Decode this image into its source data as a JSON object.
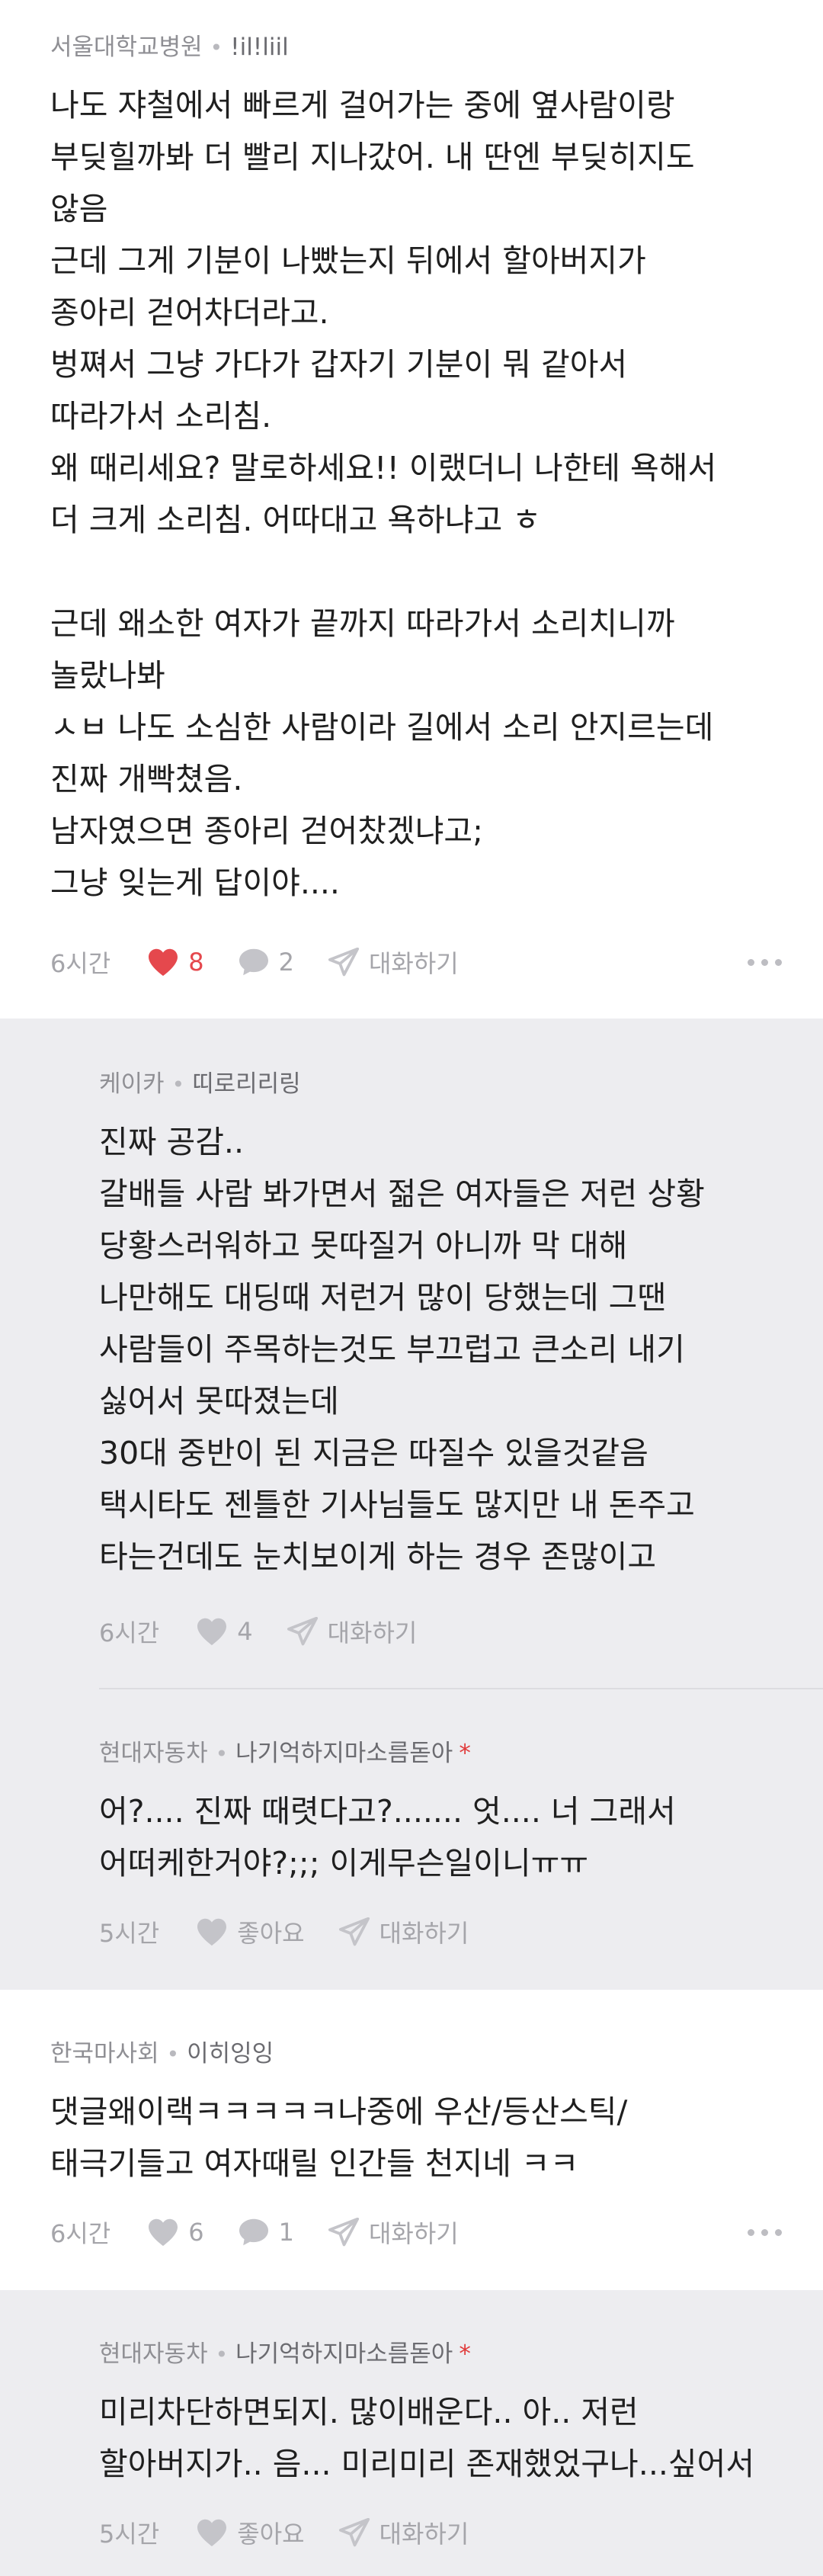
{
  "comments": [
    {
      "company": "서울대학교병원",
      "nickname": "!il!liil",
      "lines": [
        "나도 쟈철에서 빠르게 걸어가는 중에 옆사람이랑",
        "부딪힐까봐 더 빨리 지나갔어. 내 딴엔 부딪히지도",
        "않음",
        "근데 그게 기분이 나빴는지 뒤에서 할아버지가",
        "종아리 걷어차더라고.",
        "벙쪄서 그냥 가다가 갑자기 기분이 뭐 같아서",
        "따라가서 소리침.",
        "왜 때리세요? 말로하세요!! 이랬더니 나한테 욕해서",
        "더 크게 소리침. 어따대고 욕하냐고 ㅎ",
        "",
        "근데 왜소한 여자가 끝까지 따라가서 소리치니까",
        "놀랐나봐",
        "ㅅㅂ 나도 소심한 사람이라 길에서 소리 안지르는데",
        "진짜 개빡쳤음.",
        "남자였으면 종아리 걷어찼겠냐고;",
        "그냥 잊는게 답이야...."
      ],
      "time": "6시간",
      "likes": "8",
      "comments_count": "2",
      "reply_label": "대화하기"
    },
    {
      "company": "케이카",
      "nickname": "띠로리리링",
      "lines": [
        "진짜 공감..",
        "갈배들 사람 봐가면서 젊은 여자들은 저런 상황",
        "당황스러워하고 못따질거 아니까 막 대해",
        "나만해도 대딩때 저런거 많이 당했는데 그땐",
        "사람들이 주목하는것도 부끄럽고 큰소리 내기",
        "싫어서 못따졌는데",
        "30대 중반이 된 지금은 따질수 있을것같음",
        "택시타도 젠틀한 기사님들도 많지만 내 돈주고",
        "타는건데도 눈치보이게 하는 경우 존많이고"
      ],
      "time": "6시간",
      "likes": "4",
      "reply_label": "대화하기"
    },
    {
      "company": "현대자동차",
      "nickname": "나기억하지마소름돋아",
      "author_mark": "*",
      "lines": [
        "어?.... 진짜 때렷다고?....... 엇.... 너 그래서",
        "어떠케한거야?;;; 이게무슨일이니ㅠㅠ"
      ],
      "time": "5시간",
      "like_label": "좋아요",
      "reply_label": "대화하기"
    },
    {
      "company": "한국마사회",
      "nickname": "이히잉잉",
      "lines": [
        "댓글왜이랙ㅋㅋㅋㅋㅋ나중에 우산/등산스틱/",
        "태극기들고 여자때릴 인간들 천지네 ㅋㅋ"
      ],
      "time": "6시간",
      "likes": "6",
      "comments_count": "1",
      "reply_label": "대화하기"
    },
    {
      "company": "현대자동차",
      "nickname": "나기억하지마소름돋아",
      "author_mark": "*",
      "lines": [
        "미리차단하면되지. 많이배운다.. 아.. 저런",
        "할아버지가.. 음... 미리미리 존재했었구나...싶어서"
      ],
      "time": "5시간",
      "like_label": "좋아요",
      "reply_label": "대화하기"
    }
  ],
  "colors": {
    "liked": "#e5484d",
    "reply_bg": "#ededf0",
    "muted": "#a5a5aa"
  }
}
